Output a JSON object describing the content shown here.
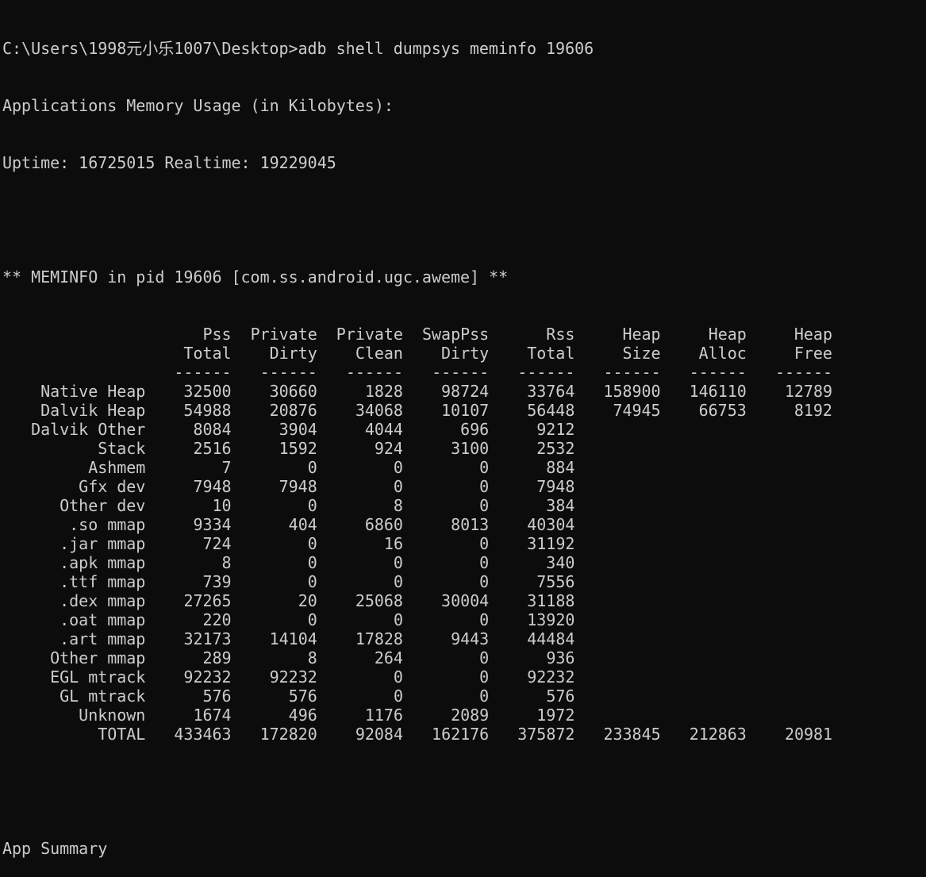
{
  "console": {
    "command_line": "C:\\Users\\1998元小乐1007\\Desktop>adb shell dumpsys meminfo 19606",
    "usage_title": "Applications Memory Usage (in Kilobytes):",
    "uptime_line": "Uptime: 16725015 Realtime: 19229045",
    "meminfo_header": "** MEMINFO in pid 19606 [com.ss.android.ugc.aweme] **"
  },
  "table": {
    "columns": [
      {
        "top": "Pss",
        "bottom": "Total"
      },
      {
        "top": "Private",
        "bottom": "Dirty"
      },
      {
        "top": "Private",
        "bottom": "Clean"
      },
      {
        "top": "SwapPss",
        "bottom": "Dirty"
      },
      {
        "top": "Rss",
        "bottom": "Total"
      },
      {
        "top": "Heap",
        "bottom": "Size"
      },
      {
        "top": "Heap",
        "bottom": "Alloc"
      },
      {
        "top": "Heap",
        "bottom": "Free"
      }
    ],
    "separator": "------",
    "rows": [
      {
        "label": "Native Heap",
        "values": [
          "32500",
          "30660",
          "1828",
          "98724",
          "33764",
          "158900",
          "146110",
          "12789"
        ]
      },
      {
        "label": "Dalvik Heap",
        "values": [
          "54988",
          "20876",
          "34068",
          "10107",
          "56448",
          "74945",
          "66753",
          "8192"
        ]
      },
      {
        "label": "Dalvik Other",
        "values": [
          "8084",
          "3904",
          "4044",
          "696",
          "9212"
        ]
      },
      {
        "label": "Stack",
        "values": [
          "2516",
          "1592",
          "924",
          "3100",
          "2532"
        ]
      },
      {
        "label": "Ashmem",
        "values": [
          "7",
          "0",
          "0",
          "0",
          "884"
        ]
      },
      {
        "label": "Gfx dev",
        "values": [
          "7948",
          "7948",
          "0",
          "0",
          "7948"
        ]
      },
      {
        "label": "Other dev",
        "values": [
          "10",
          "0",
          "8",
          "0",
          "384"
        ]
      },
      {
        "label": ".so mmap",
        "values": [
          "9334",
          "404",
          "6860",
          "8013",
          "40304"
        ]
      },
      {
        "label": ".jar mmap",
        "values": [
          "724",
          "0",
          "16",
          "0",
          "31192"
        ]
      },
      {
        "label": ".apk mmap",
        "values": [
          "8",
          "0",
          "0",
          "0",
          "340"
        ]
      },
      {
        "label": ".ttf mmap",
        "values": [
          "739",
          "0",
          "0",
          "0",
          "7556"
        ]
      },
      {
        "label": ".dex mmap",
        "values": [
          "27265",
          "20",
          "25068",
          "30004",
          "31188"
        ]
      },
      {
        "label": ".oat mmap",
        "values": [
          "220",
          "0",
          "0",
          "0",
          "13920"
        ]
      },
      {
        "label": ".art mmap",
        "values": [
          "32173",
          "14104",
          "17828",
          "9443",
          "44484"
        ]
      },
      {
        "label": "Other mmap",
        "values": [
          "289",
          "8",
          "264",
          "0",
          "936"
        ]
      },
      {
        "label": "EGL mtrack",
        "values": [
          "92232",
          "92232",
          "0",
          "0",
          "92232"
        ]
      },
      {
        "label": "GL mtrack",
        "values": [
          "576",
          "576",
          "0",
          "0",
          "576"
        ]
      },
      {
        "label": "Unknown",
        "values": [
          "1674",
          "496",
          "1176",
          "2089",
          "1972"
        ]
      },
      {
        "label": "TOTAL",
        "values": [
          "433463",
          "172820",
          "92084",
          "162176",
          "375872",
          "233845",
          "212863",
          "20981"
        ]
      }
    ]
  },
  "summary": {
    "title": "App Summary"
  }
}
